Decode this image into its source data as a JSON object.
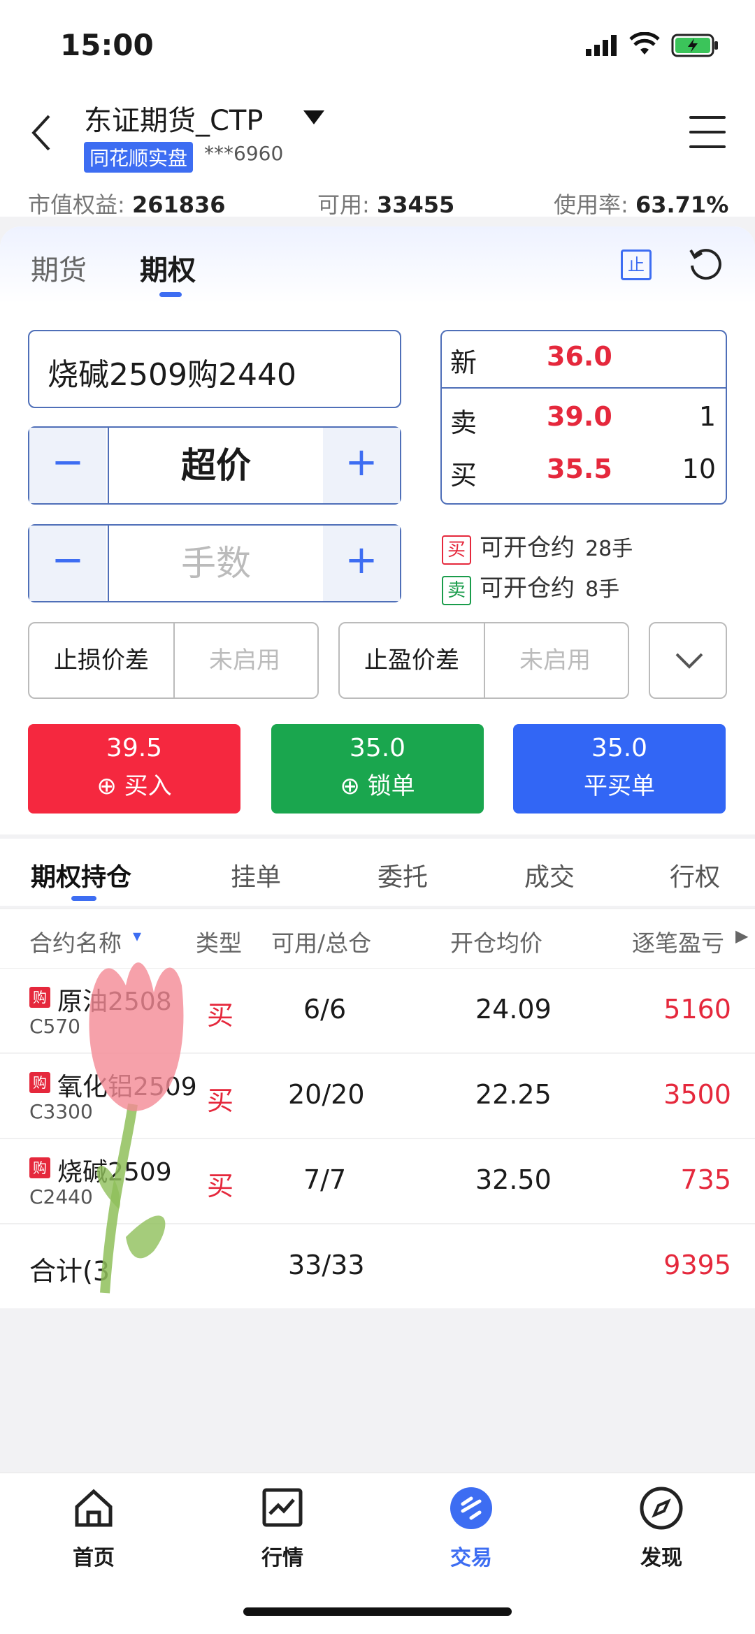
{
  "status_bar": {
    "time": "15:00"
  },
  "header": {
    "broker": "东证期货_CTP",
    "badge": "同花顺实盘",
    "account": "***6960"
  },
  "stats": {
    "equity_label": "市值权益:",
    "equity_value": "261836",
    "avail_label": "可用:",
    "avail_value": "33455",
    "usage_label": "使用率:",
    "usage_value": "63.71%"
  },
  "tabs": {
    "futures": "期货",
    "options": "期权",
    "stop_icon": "止"
  },
  "order": {
    "contract": "烧碱2509购2440",
    "price_type": "超价",
    "qty_placeholder": "手数",
    "minus": "−",
    "plus": "+",
    "stop_loss_label": "止损价差",
    "stop_loss_value": "未启用",
    "take_profit_label": "止盈价差",
    "take_profit_value": "未启用"
  },
  "quote": {
    "last_label": "新",
    "last": "36.0",
    "ask_label": "卖",
    "ask": "39.0",
    "ask_vol": "1",
    "bid_label": "买",
    "bid": "35.5",
    "bid_vol": "10"
  },
  "openable": {
    "buy_tag": "买",
    "buy_text": "可开仓约",
    "buy_qty": "28手",
    "sell_tag": "卖",
    "sell_text": "可开仓约",
    "sell_qty": "8手"
  },
  "buttons": {
    "buy_price": "39.5",
    "buy_label": "买入",
    "lock_price": "35.0",
    "lock_label": "锁单",
    "close_price": "35.0",
    "close_label": "平买单"
  },
  "position_tabs": [
    "期权持仓",
    "挂单",
    "委托",
    "成交",
    "行权"
  ],
  "table": {
    "headers": [
      "合约名称",
      "类型",
      "可用/总仓",
      "开仓均价",
      "逐笔盈亏"
    ],
    "rows": [
      {
        "tag": "购",
        "name": "原油2508",
        "code": "C570",
        "type": "买",
        "qty": "6/6",
        "avg": "24.09",
        "pnl": "5160"
      },
      {
        "tag": "购",
        "name": "氧化铝2509",
        "code": "C3300",
        "type": "买",
        "qty": "20/20",
        "avg": "22.25",
        "pnl": "3500"
      },
      {
        "tag": "购",
        "name": "烧碱2509",
        "code": "C2440",
        "type": "买",
        "qty": "7/7",
        "avg": "32.50",
        "pnl": "735"
      }
    ],
    "total_label": "合计(3",
    "total_qty": "33/33",
    "total_pnl": "9395"
  },
  "nav": [
    {
      "label": "首页",
      "icon": "home-icon"
    },
    {
      "label": "行情",
      "icon": "chart-icon"
    },
    {
      "label": "交易",
      "icon": "trade-icon"
    },
    {
      "label": "发现",
      "icon": "compass-icon"
    }
  ],
  "colors": {
    "accent": "#3d6df2",
    "red": "#e5283c",
    "green": "#1a9c4b"
  }
}
